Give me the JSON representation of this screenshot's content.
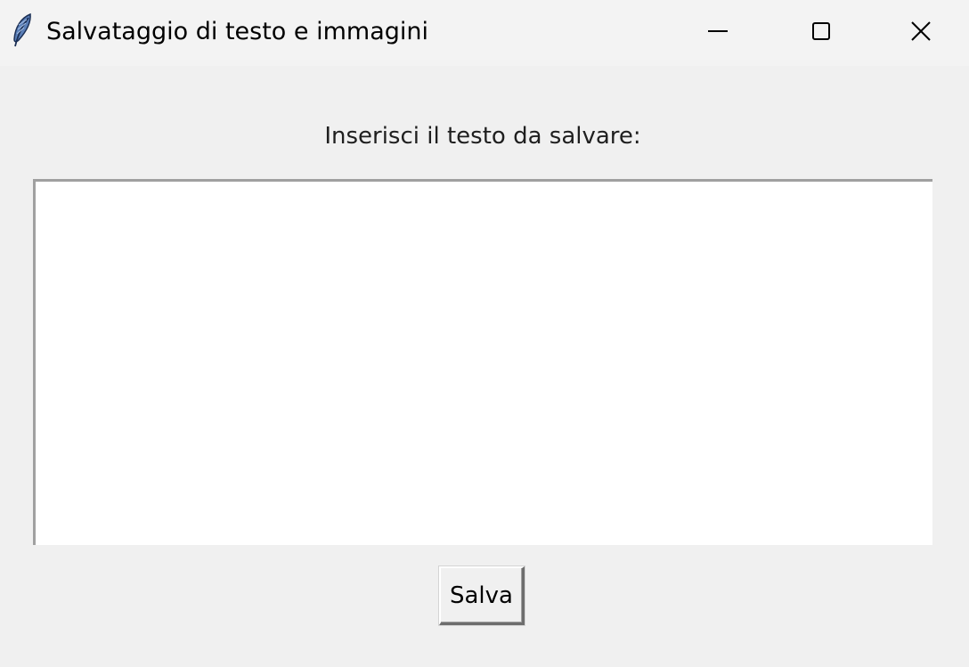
{
  "window": {
    "title": "Salvataggio di testo e immagini",
    "app_icon": "feather-icon",
    "controls": {
      "minimize_icon": "minimize-icon",
      "maximize_icon": "maximize-icon",
      "close_icon": "close-icon"
    }
  },
  "main": {
    "prompt_label": "Inserisci il testo da salvare:",
    "text_input": {
      "value": "",
      "placeholder": ""
    },
    "save_button_label": "Salva"
  },
  "colors": {
    "titlebar_bg": "#f3f3f3",
    "window_bg": "#f0f0f0",
    "textarea_bg": "#ffffff"
  }
}
